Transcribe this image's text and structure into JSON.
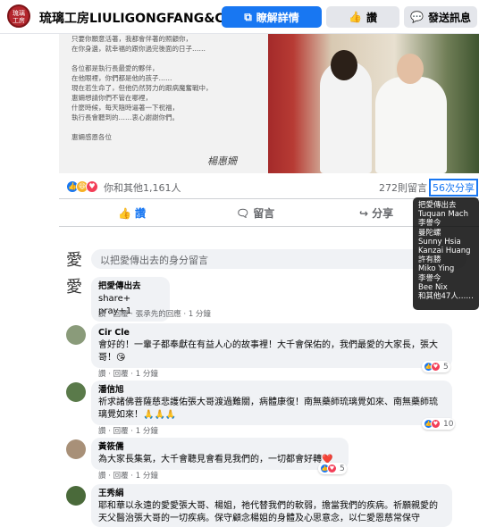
{
  "header": {
    "brand": "琉璃工房LIULIGONGFANG&CO.",
    "learn_more": "瞭解詳情",
    "like": "讚",
    "message": "發送訊息"
  },
  "post": {
    "letter_lines": "只要你願意活著，我都會伴著的照顧你，\n在你身邊，就幸福的跟你過完後面的日子……\n\n各位都是執行長最愛的夥伴，\n在他眼裡，你們都是他的孩子……\n現在若生命了，但他仍然努力的跟病魔奮戰中，\n惠姍想請你們不管在哪裡，\n什麼時候，每天隨時逼著一下祝福，\n執行長會聽到的……衷心謝謝你們。\n\n惠姍感恩各位",
    "signature": "楊惠姍",
    "reactions_text": "你和其他1,161人",
    "comments_text": "272則留言",
    "shares_text": "56次分享"
  },
  "actions": {
    "like": "讚",
    "comment": "留言",
    "share": "分享"
  },
  "tooltip": [
    "把愛傳出去",
    "Tuquan Mach",
    "李譽今",
    "曼陀螺",
    "Sunny Hsia",
    "Kanzai Huang",
    "許有勝",
    "Miko Ying",
    "李譽今",
    "Bee Nix",
    "和其他47人……"
  ],
  "comment_input": {
    "avatar_char": "愛",
    "placeholder": "以把愛傳出去的身分留言"
  },
  "comments": [
    {
      "name": "把愛傳出去",
      "text": "share+ pray+1",
      "meta": "讚 · 回覆 · 張承先的回應 · 1 分鐘",
      "avatar_char": "愛"
    },
    {
      "name": "Cir Cle",
      "text": "會好的！一輩子都奉獻在有益人心的故事裡！大千會保佑的，我們最愛的大家長，張大哥！😘",
      "meta": "讚 · 回覆 · 1 分鐘",
      "count": "5"
    },
    {
      "name": "潘信旭",
      "text": "祈求諸佛菩薩慈悲護佑張大哥渡過難關，病體康復！南無藥師琉璃覺如來、南無藥師琉璃覺如來！🙏🙏🙏",
      "meta": "讚 · 回覆 · 1 分鐘",
      "count": "10"
    },
    {
      "name": "黃筱儒",
      "text": "為大家長集氣，大千會聽見會看見我們的，一切都會好轉❤️",
      "meta": "讚 · 回覆 · 1 分鐘",
      "count": "5"
    },
    {
      "name": "王秀絹",
      "text": "耶和華以永遠的愛愛張大哥、楊姐，祂代替我們的軟弱，擔當我們的疾病。祈願親愛的天父醫治張大哥的一切疾病。保守顧念楊姐的身體及心思意念，以仁愛恩慈常保守"
    }
  ]
}
